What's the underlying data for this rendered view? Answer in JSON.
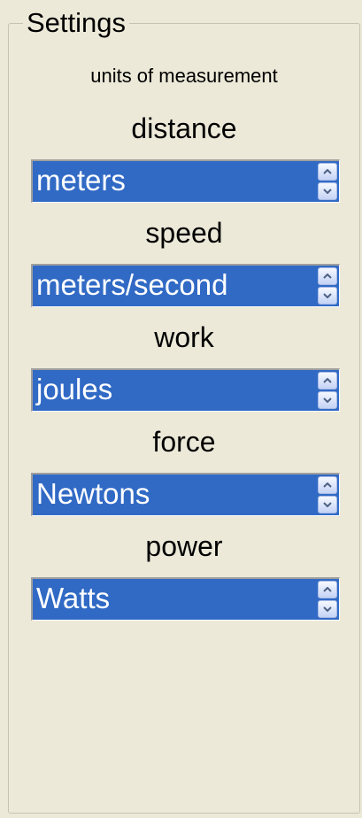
{
  "settings": {
    "title": "Settings",
    "subtitle": "units of measurement",
    "units": [
      {
        "label": "distance",
        "value": "meters"
      },
      {
        "label": "speed",
        "value": "meters/second"
      },
      {
        "label": "work",
        "value": "joules"
      },
      {
        "label": "force",
        "value": "Newtons"
      },
      {
        "label": "power",
        "value": "Watts"
      }
    ]
  },
  "icons": {
    "up": "chevron-up-icon",
    "down": "chevron-down-icon"
  },
  "colors": {
    "panel_background": "#ece9d8",
    "selection_background": "#316ac5",
    "selection_text": "#ffffff",
    "spin_arrow": "#4d6185"
  }
}
